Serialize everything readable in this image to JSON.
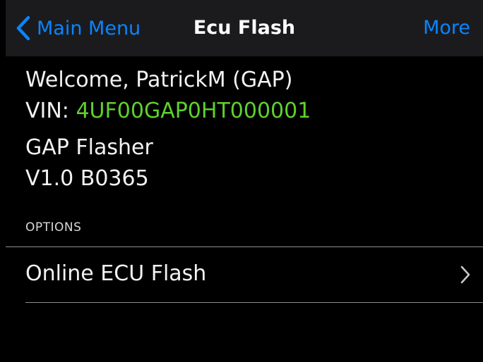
{
  "nav": {
    "back_label": "Main Menu",
    "title": "Ecu Flash",
    "more_label": "More",
    "accent_color": "#0a84ff"
  },
  "info": {
    "welcome": "Welcome, PatrickM (GAP)",
    "vin_label": "VIN: ",
    "vin_value": "4UF00GAP0HT000001",
    "vin_color": "#5fd12d",
    "app_name": "GAP Flasher",
    "app_version": "V1.0 B0365"
  },
  "options": {
    "header": "OPTIONS",
    "items": [
      {
        "label": "Online ECU Flash",
        "icon": "chevron-right-icon"
      }
    ]
  }
}
